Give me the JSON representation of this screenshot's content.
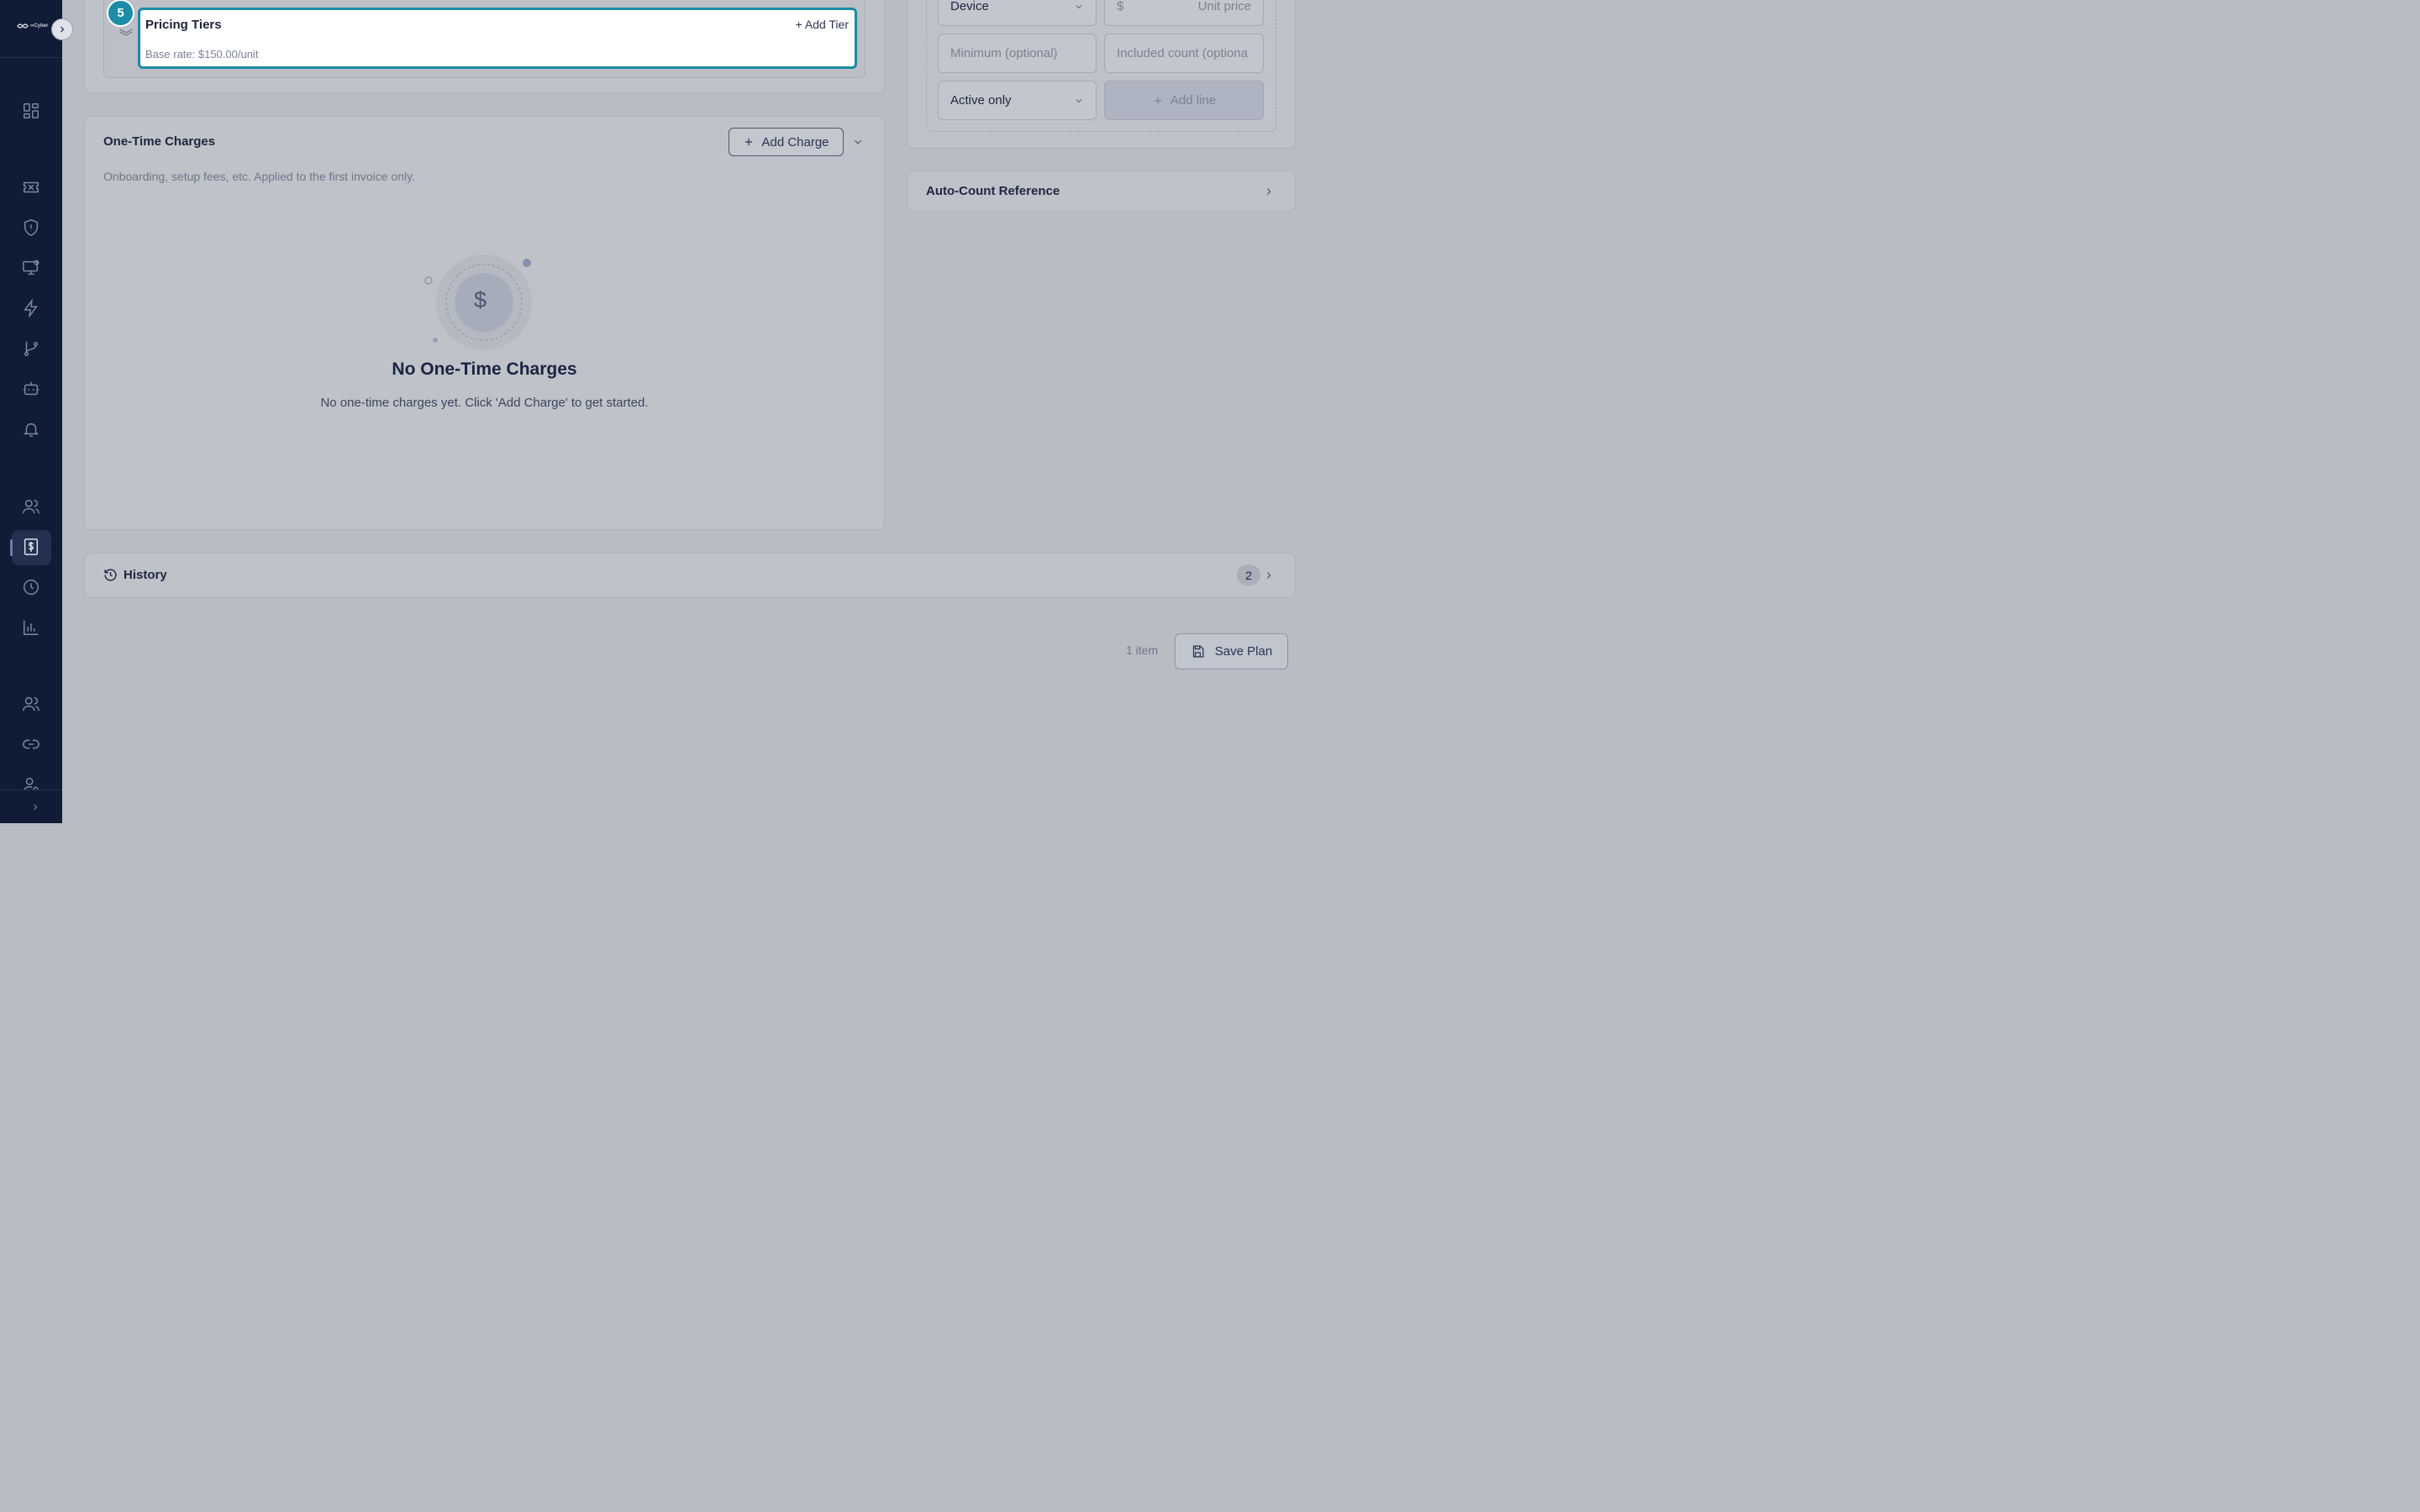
{
  "sidebar": {
    "logo_text": "∞Cyber",
    "icons": [
      "dashboard-icon",
      "ticket-icon",
      "shield-alert-icon",
      "monitor-settings-icon",
      "zap-icon",
      "git-branch-icon",
      "bot-icon",
      "bell-icon",
      "users-icon",
      "billing-icon",
      "clock-icon",
      "bar-chart-icon",
      "team-icon",
      "link-icon",
      "user-settings-icon"
    ],
    "active": "billing-icon"
  },
  "pricing_tiers": {
    "step": "5",
    "title": "Pricing Tiers",
    "add_label": "+ Add Tier",
    "base_rate": "Base rate: $150.00/unit"
  },
  "one_time": {
    "title": "One-Time Charges",
    "add_label": "Add Charge",
    "description": "Onboarding, setup fees, etc. Applied to the first invoice only.",
    "empty_title": "No One-Time Charges",
    "empty_desc": "No one-time charges yet. Click 'Add Charge' to get started.",
    "empty_icon_glyph": "$"
  },
  "line_form": {
    "type_value": "Device",
    "currency": "$",
    "unit_price_placeholder": "Unit price",
    "minimum_placeholder": "Minimum (optional)",
    "included_placeholder": "Included count (optiona",
    "filter_value": "Active only",
    "add_line_label": "Add line"
  },
  "auto_count": {
    "title": "Auto-Count Reference"
  },
  "history": {
    "title": "History",
    "count": "2"
  },
  "footer": {
    "item_count": "1 item",
    "save_label": "Save Plan"
  }
}
